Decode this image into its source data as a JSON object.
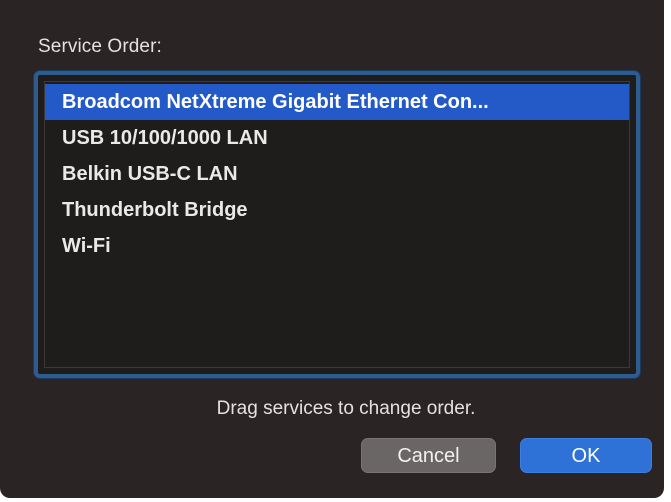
{
  "dialog": {
    "title": "Service Order:",
    "hint": "Drag services to change order.",
    "cancel_label": "Cancel",
    "ok_label": "OK",
    "accent_color": "#2459c8"
  },
  "services": [
    {
      "label": "Broadcom NetXtreme Gigabit Ethernet Con...",
      "selected": true
    },
    {
      "label": "USB 10/100/1000 LAN",
      "selected": false
    },
    {
      "label": "Belkin USB-C LAN",
      "selected": false
    },
    {
      "label": "Thunderbolt Bridge",
      "selected": false
    },
    {
      "label": "Wi-Fi",
      "selected": false
    }
  ]
}
